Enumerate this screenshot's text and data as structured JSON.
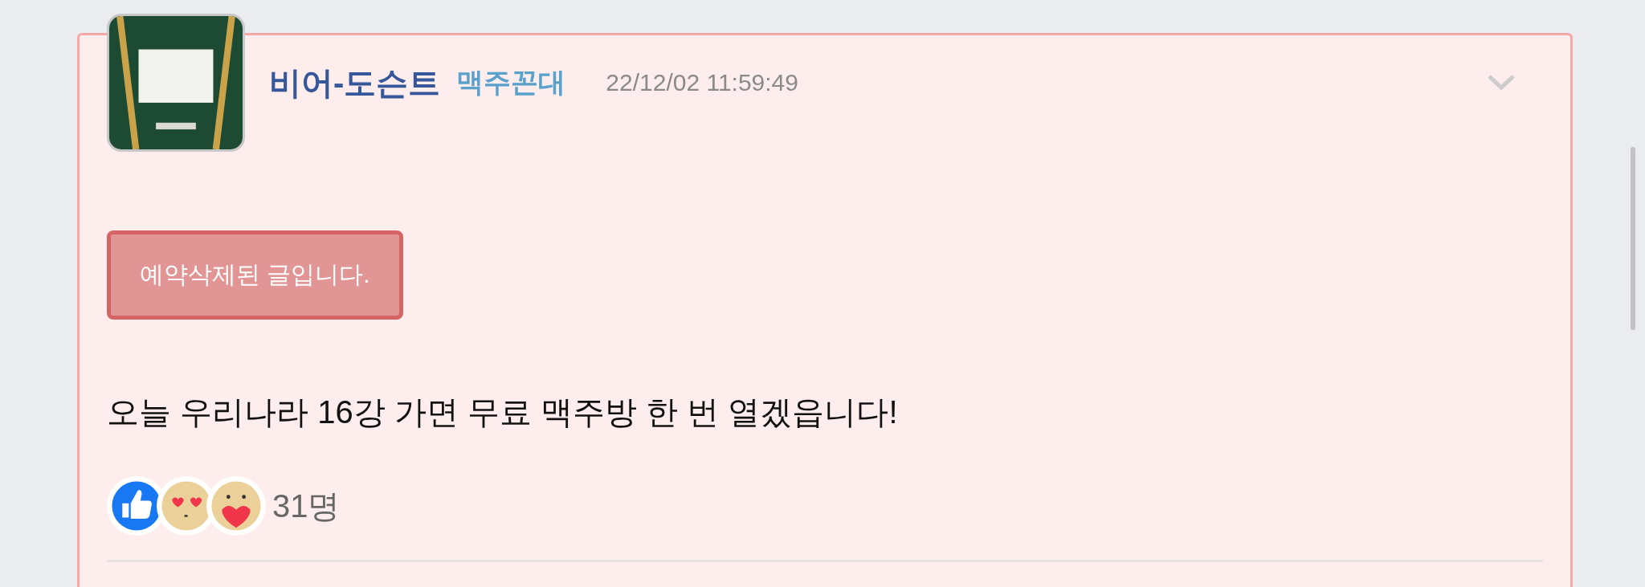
{
  "post": {
    "author": "비어-도슨트",
    "badge": "맥주꼰대",
    "time": "22/12/02 11:59:49",
    "notice": "예약삭제된 글입니다.",
    "body": "오늘 우리나라 16강 가면 무료 맥주방 한 번 열겠읍니다!",
    "reactions": [
      {
        "kind": "like"
      },
      {
        "kind": "heart-eyes"
      },
      {
        "kind": "hug"
      }
    ],
    "reaction_count": "31명"
  }
}
